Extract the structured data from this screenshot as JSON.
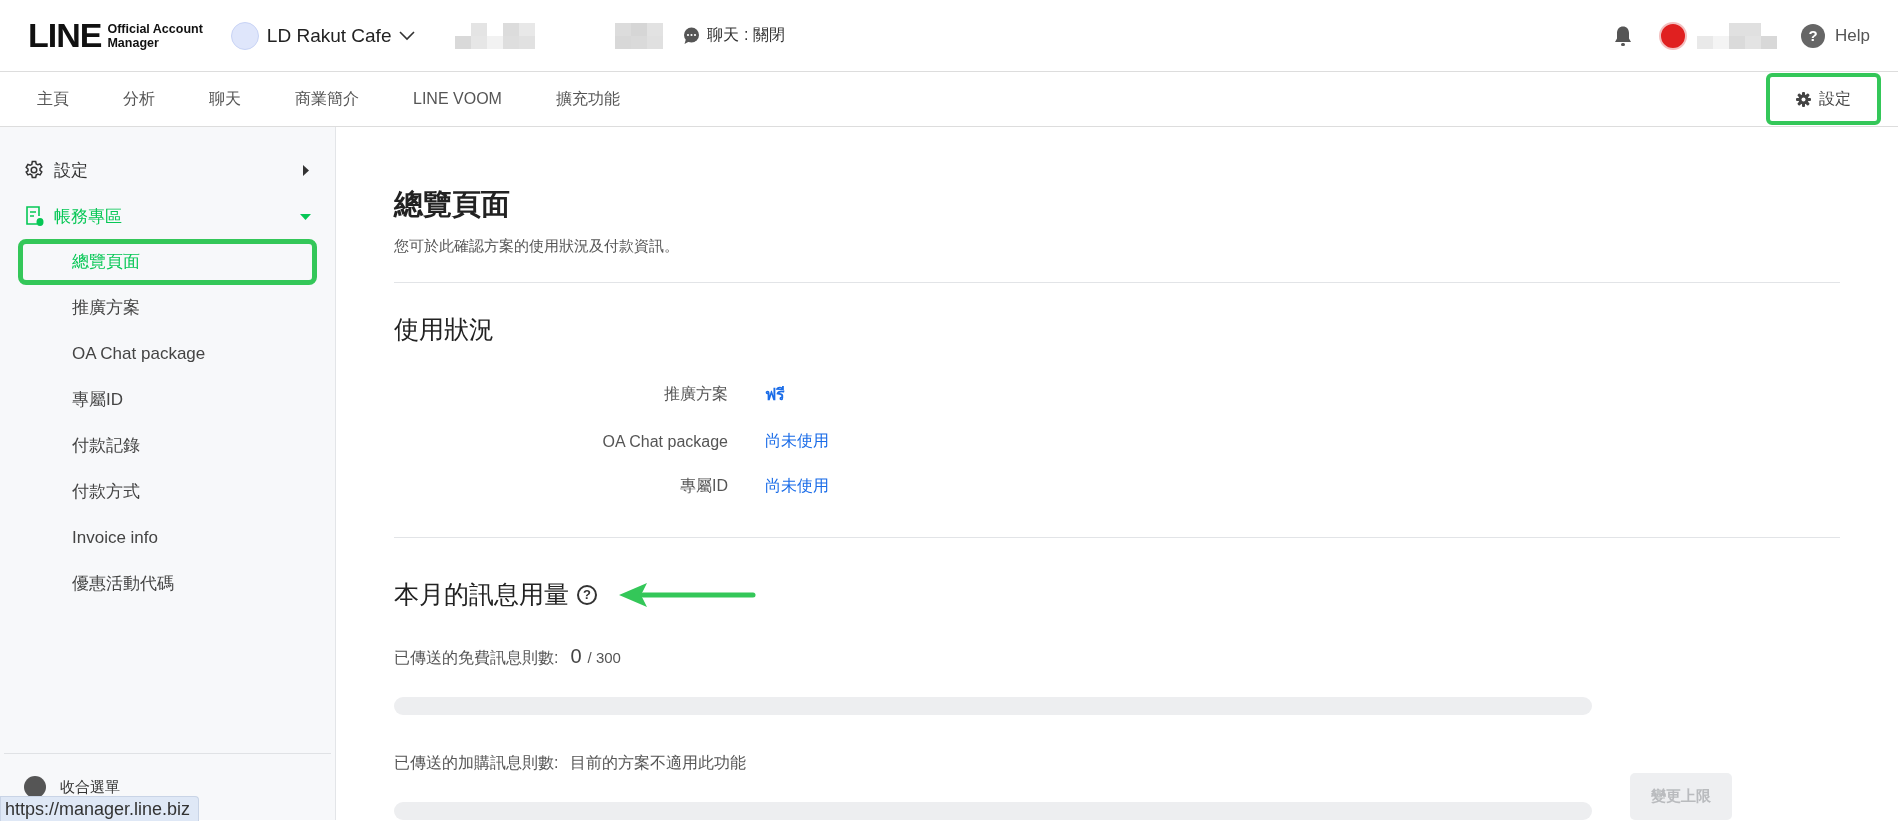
{
  "header": {
    "logo": {
      "wordmark": "LINE",
      "line_1": "Official Account",
      "line_2": "Manager"
    },
    "account": {
      "name": "LD Rakut Cafe"
    },
    "chat_status": "聊天 : 關閉",
    "help": {
      "mark": "?",
      "label": "Help"
    }
  },
  "nav": {
    "items": [
      {
        "label": "主頁",
        "selected": false
      },
      {
        "label": "分析",
        "selected": false
      },
      {
        "label": "聊天",
        "selected": false
      },
      {
        "label": "商業簡介",
        "selected": false
      },
      {
        "label": "LINE VOOM",
        "selected": false
      },
      {
        "label": "擴充功能",
        "selected": false
      }
    ],
    "settings": {
      "label": "設定",
      "highlighted": true
    }
  },
  "sidebar": {
    "groups": [
      {
        "label": "設定",
        "expanded": false,
        "selected": false
      },
      {
        "label": "帳務專區",
        "expanded": true,
        "selected": true,
        "children": [
          {
            "label": "總覽頁面",
            "selected": true,
            "highlighted": true
          },
          {
            "label": "推廣方案",
            "selected": false,
            "highlighted": false
          },
          {
            "label": "OA Chat package",
            "selected": false,
            "highlighted": false
          },
          {
            "label": "專屬ID",
            "selected": false,
            "highlighted": false
          },
          {
            "label": "付款記錄",
            "selected": false,
            "highlighted": false
          },
          {
            "label": "付款方式",
            "selected": false,
            "highlighted": false
          },
          {
            "label": "Invoice info",
            "selected": false,
            "highlighted": false
          },
          {
            "label": "優惠活動代碼",
            "selected": false,
            "highlighted": false
          }
        ]
      }
    ],
    "collapse": "收合選單"
  },
  "status_bar": {
    "url": "https://manager.line.biz"
  },
  "page": {
    "title": "總覽頁面",
    "subtitle": "您可於此確認方案的使用狀況及付款資訊。",
    "usage": {
      "heading": "使用狀況",
      "rows": [
        {
          "label": "推廣方案",
          "value": "ฟรี",
          "bold": true
        },
        {
          "label": "OA Chat package",
          "value": "尚未使用",
          "bold": false
        },
        {
          "label": "專屬ID",
          "value": "尚未使用",
          "bold": false
        }
      ]
    },
    "messages": {
      "heading": "本月的訊息用量",
      "help_mark": "?",
      "annotated": true,
      "meters": [
        {
          "label": "已傳送的免費訊息則數:",
          "count": "0",
          "total": "/ 300",
          "level": 0
        },
        {
          "label": "已傳送的加購訊息則數:",
          "note": "目前的方案不適用此功能",
          "level": 0
        }
      ],
      "button": {
        "label": "變更上限",
        "disabled": true
      }
    }
  }
}
